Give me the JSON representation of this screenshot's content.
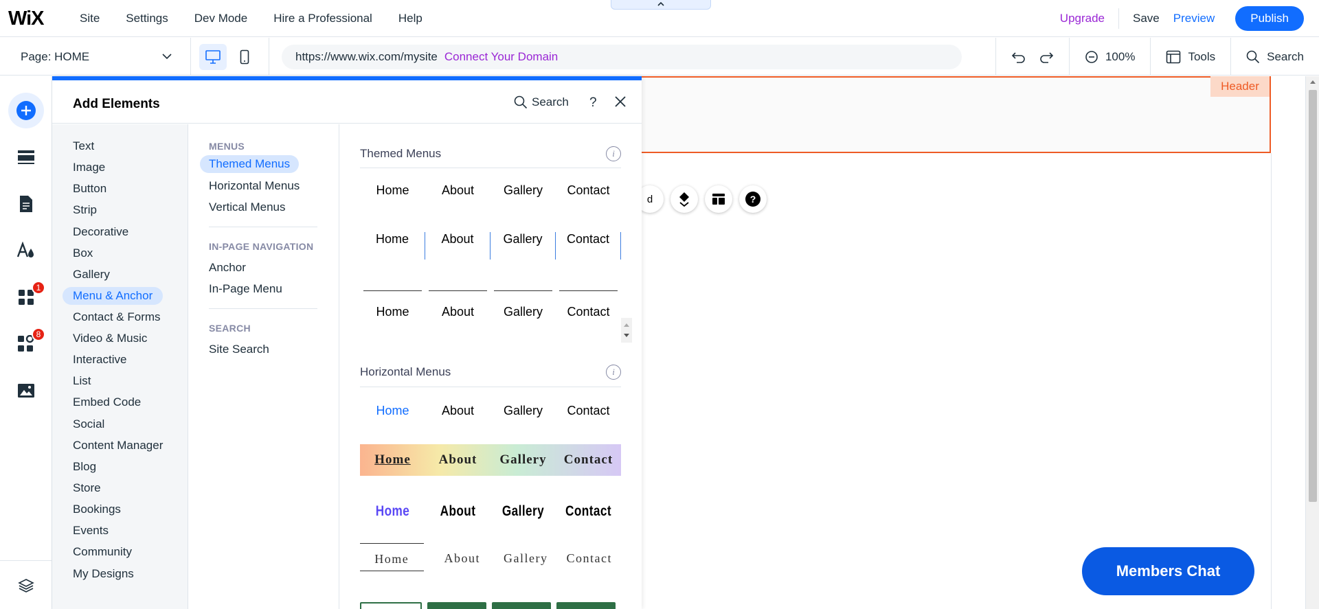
{
  "app": {
    "logo": "WiX",
    "nav": [
      "Site",
      "Settings",
      "Dev Mode",
      "Hire a Professional",
      "Help"
    ],
    "top_tab_icon": "chevron-up-icon",
    "upgrade": "Upgrade",
    "save": "Save",
    "preview": "Preview",
    "publish": "Publish"
  },
  "subbar": {
    "page_label": "Page: HOME",
    "url": "https://www.wix.com/mysite",
    "connect_domain": "Connect Your Domain",
    "zoom": "100%",
    "tools": "Tools",
    "search": "Search"
  },
  "leftbar": {
    "items": [
      "add-elements-icon",
      "sections-icon",
      "pages-icon",
      "design-icon",
      "apps-icon",
      "business-icon",
      "media-icon",
      "layers-icon"
    ],
    "badges": {
      "apps": "1",
      "business": "8"
    }
  },
  "panel": {
    "title": "Add Elements",
    "search_label": "Search",
    "help": "?",
    "categories": [
      "Text",
      "Image",
      "Button",
      "Strip",
      "Decorative",
      "Box",
      "Gallery",
      "Menu & Anchor",
      "Contact & Forms",
      "Video & Music",
      "Interactive",
      "List",
      "Embed Code",
      "Social",
      "Content Manager",
      "Blog",
      "Store",
      "Bookings",
      "Events",
      "Community",
      "My Designs"
    ],
    "selected_category": "Menu & Anchor",
    "sections": [
      {
        "heading": "MENUS",
        "items": [
          "Themed Menus",
          "Horizontal Menus",
          "Vertical Menus"
        ]
      },
      {
        "heading": "IN-PAGE NAVIGATION",
        "items": [
          "Anchor",
          "In-Page Menu"
        ]
      },
      {
        "heading": "SEARCH",
        "items": [
          "Site Search"
        ]
      }
    ],
    "selected_sub": "Themed Menus",
    "preview_groups": {
      "themed": "Themed Menus",
      "horizontal": "Horizontal Menus"
    },
    "menu_items": [
      "Home",
      "About",
      "Gallery",
      "Contact"
    ],
    "accent_home": "#116dff",
    "purple_home": "#5a48f5"
  },
  "canvas": {
    "header_tag": "Header",
    "members_chat": "Members Chat",
    "float_partial_text": "d"
  },
  "colors": {
    "accent": "#116dff",
    "upgrade": "#9a27d5",
    "header_orange": "#ee5b25",
    "badge": "#e62214"
  }
}
